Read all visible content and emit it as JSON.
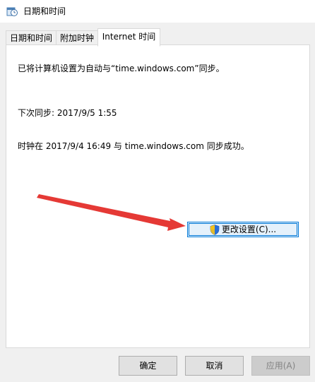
{
  "window": {
    "title": "日期和时间",
    "icon": "clock-calendar-icon"
  },
  "tabs": [
    {
      "label": "日期和时间",
      "active": false
    },
    {
      "label": "附加时钟",
      "active": false
    },
    {
      "label": "Internet 时间",
      "active": true
    }
  ],
  "panel": {
    "sync_info": "已将计算机设置为自动与“time.windows.com”同步。",
    "next_sync": "下次同步: 2017/9/5 1:55",
    "last_sync": "时钟在 2017/9/4 16:49 与 time.windows.com 同步成功。",
    "change_settings_label": "更改设置(C)...",
    "change_settings_icon": "uac-shield-icon"
  },
  "footer": {
    "ok_label": "确定",
    "cancel_label": "取消",
    "apply_label": "应用(A)"
  },
  "annotation": {
    "color": "#e53935",
    "icon": "red-arrow-annotation"
  }
}
